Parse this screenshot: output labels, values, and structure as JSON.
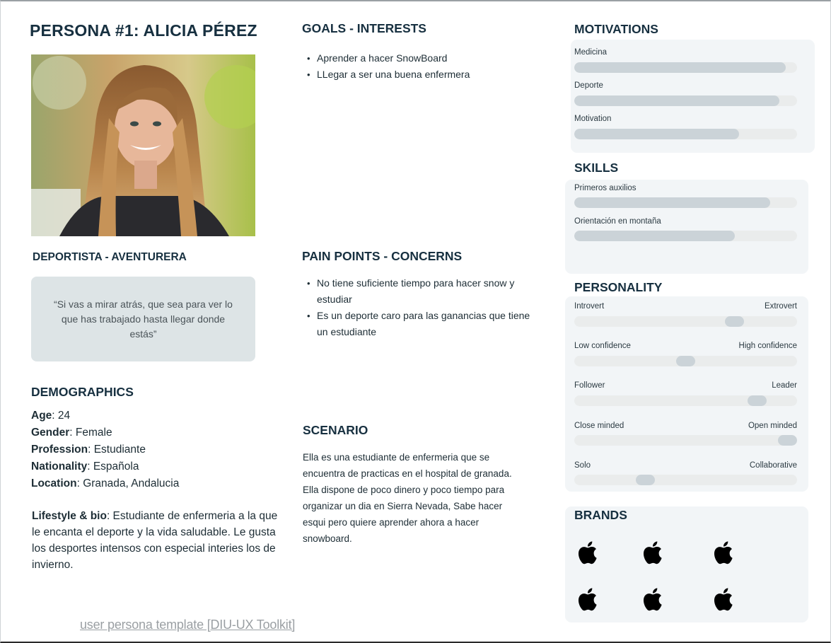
{
  "header": {
    "title": "PERSONA #1:  ALICIA PÉREZ"
  },
  "profile": {
    "subtitle": "DEPORTISTA -  AVENTURERA",
    "quote": "“Si vas a mirar atrás, que sea para ver lo que has trabajado hasta llegar donde estás”"
  },
  "demographics": {
    "heading": "DEMOGRAPHICS",
    "rows": [
      {
        "label": "Age",
        "value": ": 24"
      },
      {
        "label": "Gender",
        "value": ": Female"
      },
      {
        "label": "Profession",
        "value": ": Estudiante"
      },
      {
        "label": "Nationality",
        "value": ": Española"
      },
      {
        "label": "Location",
        "value": ": Granada, Andalucia"
      }
    ],
    "bio_label": "Lifestyle & bio",
    "bio_text": ": Estudiante de enfermeria a la que le encanta el deporte y la vida saludable.  Le gusta los desportes intensos con especial interies los de invierno."
  },
  "goals": {
    "heading": "GOALS - INTERESTS",
    "items": [
      "Aprender  a hacer SnowBoard",
      "LLegar a ser una buena enfermera"
    ]
  },
  "pain_points": {
    "heading": "PAIN POINTS - CONCERNS",
    "items": [
      "No tiene suficiente tiempo para hacer snow y estudiar",
      "Es un deporte caro para las ganancias que tiene un estudiante"
    ]
  },
  "scenario": {
    "heading": "SCENARIO",
    "text": "Ella es una estudiante de enfermeria que se encuentra de practicas en el hospital de granada. Ella dispone de poco dinero y poco tiempo para organizar un dia en Sierra Nevada, Sabe hacer esqui pero quiere aprender ahora a hacer snowboard."
  },
  "motivations": {
    "heading": "MOTIVATIONS",
    "items": [
      {
        "label": "Medicina",
        "level": 0.95
      },
      {
        "label": "Deporte",
        "level": 0.92
      },
      {
        "label": "Motivation",
        "level": 0.74
      }
    ]
  },
  "skills": {
    "heading": "SKILLS",
    "items": [
      {
        "label": "Primeros auxilios",
        "level": 0.88
      },
      {
        "label": "Orientación en montaña",
        "level": 0.72
      }
    ]
  },
  "personality": {
    "heading": "PERSONALITY",
    "traits": [
      {
        "left": "Introvert",
        "right": "Extrovert",
        "level": 0.72
      },
      {
        "left": "Low confidence",
        "right": "High confidence",
        "level": 0.5
      },
      {
        "left": "Follower",
        "right": "Leader",
        "level": 0.82
      },
      {
        "left": "Close minded",
        "right": "Open minded",
        "level": 0.98
      },
      {
        "left": "Solo",
        "right": "Collaborative",
        "level": 0.32
      }
    ]
  },
  "brands": {
    "heading": "BRANDS",
    "icons": [
      "apple-logo",
      "apple-logo",
      "apple-logo",
      "apple-logo",
      "apple-logo",
      "apple-logo"
    ]
  },
  "footer": {
    "link": "user persona template [DIU-UX Toolkit]"
  }
}
